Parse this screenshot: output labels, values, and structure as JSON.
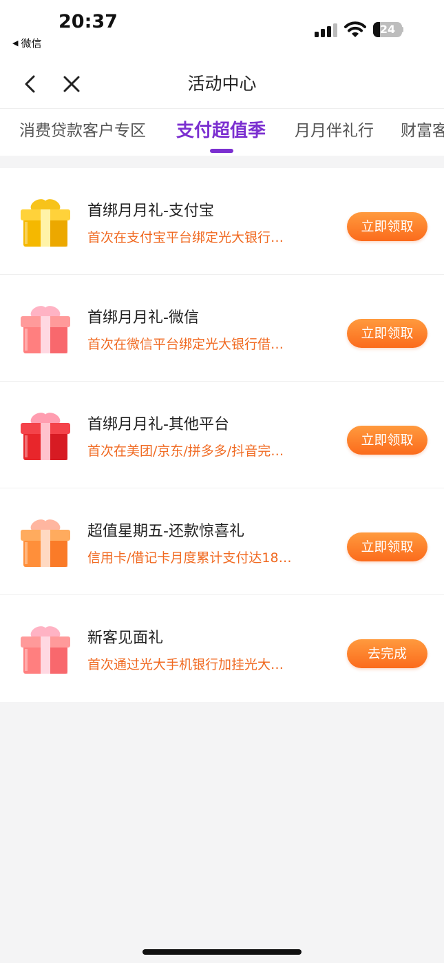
{
  "status_bar": {
    "time": "20:37",
    "back_app": "微信",
    "battery": "24",
    "battery_level": 0.24
  },
  "nav": {
    "title": "活动中心"
  },
  "tabs": [
    {
      "label": "消费贷款客户专区",
      "active": false
    },
    {
      "label": "支付超值季",
      "active": true
    },
    {
      "label": "月月伴礼行",
      "active": false
    },
    {
      "label": "财富客",
      "active": false
    }
  ],
  "items": [
    {
      "title": "首绑月月礼-支付宝",
      "desc": "首次在支付宝平台绑定光大银行…",
      "button": "立即领取",
      "gift_color": "gold"
    },
    {
      "title": "首绑月月礼-微信",
      "desc": "首次在微信平台绑定光大银行借…",
      "button": "立即领取",
      "gift_color": "pink"
    },
    {
      "title": "首绑月月礼-其他平台",
      "desc": "首次在美团/京东/拼多多/抖音完…",
      "button": "立即领取",
      "gift_color": "red"
    },
    {
      "title": "超值星期五-还款惊喜礼",
      "desc": "信用卡/借记卡月度累计支付达18…",
      "button": "立即领取",
      "gift_color": "orange"
    },
    {
      "title": "新客见面礼",
      "desc": "首次通过光大手机银行加挂光大…",
      "button": "去完成",
      "gift_color": "pink"
    }
  ],
  "colors": {
    "accent": "#7b2fd0",
    "button": "#fb6b1c",
    "desc": "#f06a22"
  }
}
